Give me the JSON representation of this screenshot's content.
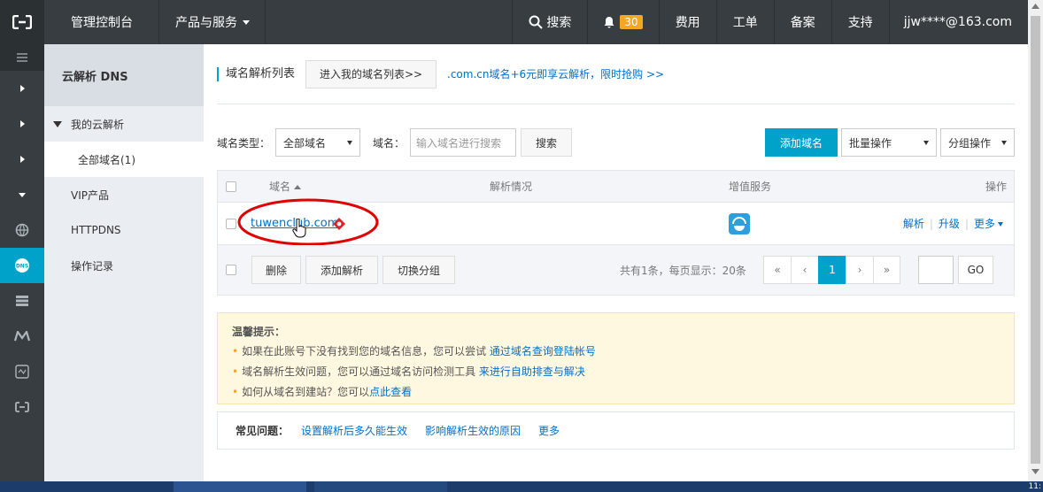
{
  "topbar": {
    "console": "管理控制台",
    "products": "产品与服务",
    "search": "搜索",
    "notifications_count": "30",
    "billing": "费用",
    "tickets": "工单",
    "icp": "备案",
    "support": "支持",
    "user": "jjw****@163.com"
  },
  "sidebar": {
    "title": "云解析 DNS",
    "group": "我的云解析",
    "all_domains": "全部域名(1)",
    "items": [
      "VIP产品",
      "HTTPDNS",
      "操作记录"
    ]
  },
  "header": {
    "title": "域名解析列表",
    "my_domains_button": "进入我的域名列表>>",
    "promo": ".com.cn域名+6元即享云解析，限时抢购 >>"
  },
  "filters": {
    "type_label": "域名类型：",
    "type_value": "全部域名",
    "domain_label": "域名：",
    "domain_placeholder": "输入域名进行搜索",
    "search_button": "搜索",
    "add_domain_button": "添加域名",
    "batch_select": "批量操作",
    "group_select": "分组操作"
  },
  "table": {
    "columns": [
      "域名",
      "解析情况",
      "增值服务",
      "操作"
    ],
    "rows": [
      {
        "domain": "tuwenclub.com",
        "ops": [
          "解析",
          "升级",
          "更多"
        ]
      }
    ],
    "footer_buttons": [
      "删除",
      "添加解析",
      "切换分组"
    ],
    "summary": "共有1条，每页显示：20条",
    "pager": [
      "«",
      "‹",
      "1",
      "›",
      "»"
    ],
    "current_page": 1,
    "go_button": "GO"
  },
  "notice": {
    "title": "温馨提示：",
    "lines": [
      {
        "text": "如果在此账号下没有找到您的域名信息，您可以尝试 ",
        "link": "通过域名查询登陆帐号"
      },
      {
        "text": "域名解析生效问题，您可以通过域名访问检测工具 ",
        "link": "来进行自助排查与解决"
      },
      {
        "text": "如何从域名到建站？您可以",
        "link": "点此查看"
      }
    ]
  },
  "faq": {
    "label": "常见问题：",
    "links": [
      "设置解析后多久能生效",
      "影响解析生效的原因",
      "更多"
    ]
  },
  "taskbar": {
    "clock": "11:"
  },
  "colors": {
    "accent": "#00a2ca",
    "topbar": "#373d41",
    "link": "#0070cc",
    "badge": "#f5a623",
    "annotation": "#e00000"
  }
}
